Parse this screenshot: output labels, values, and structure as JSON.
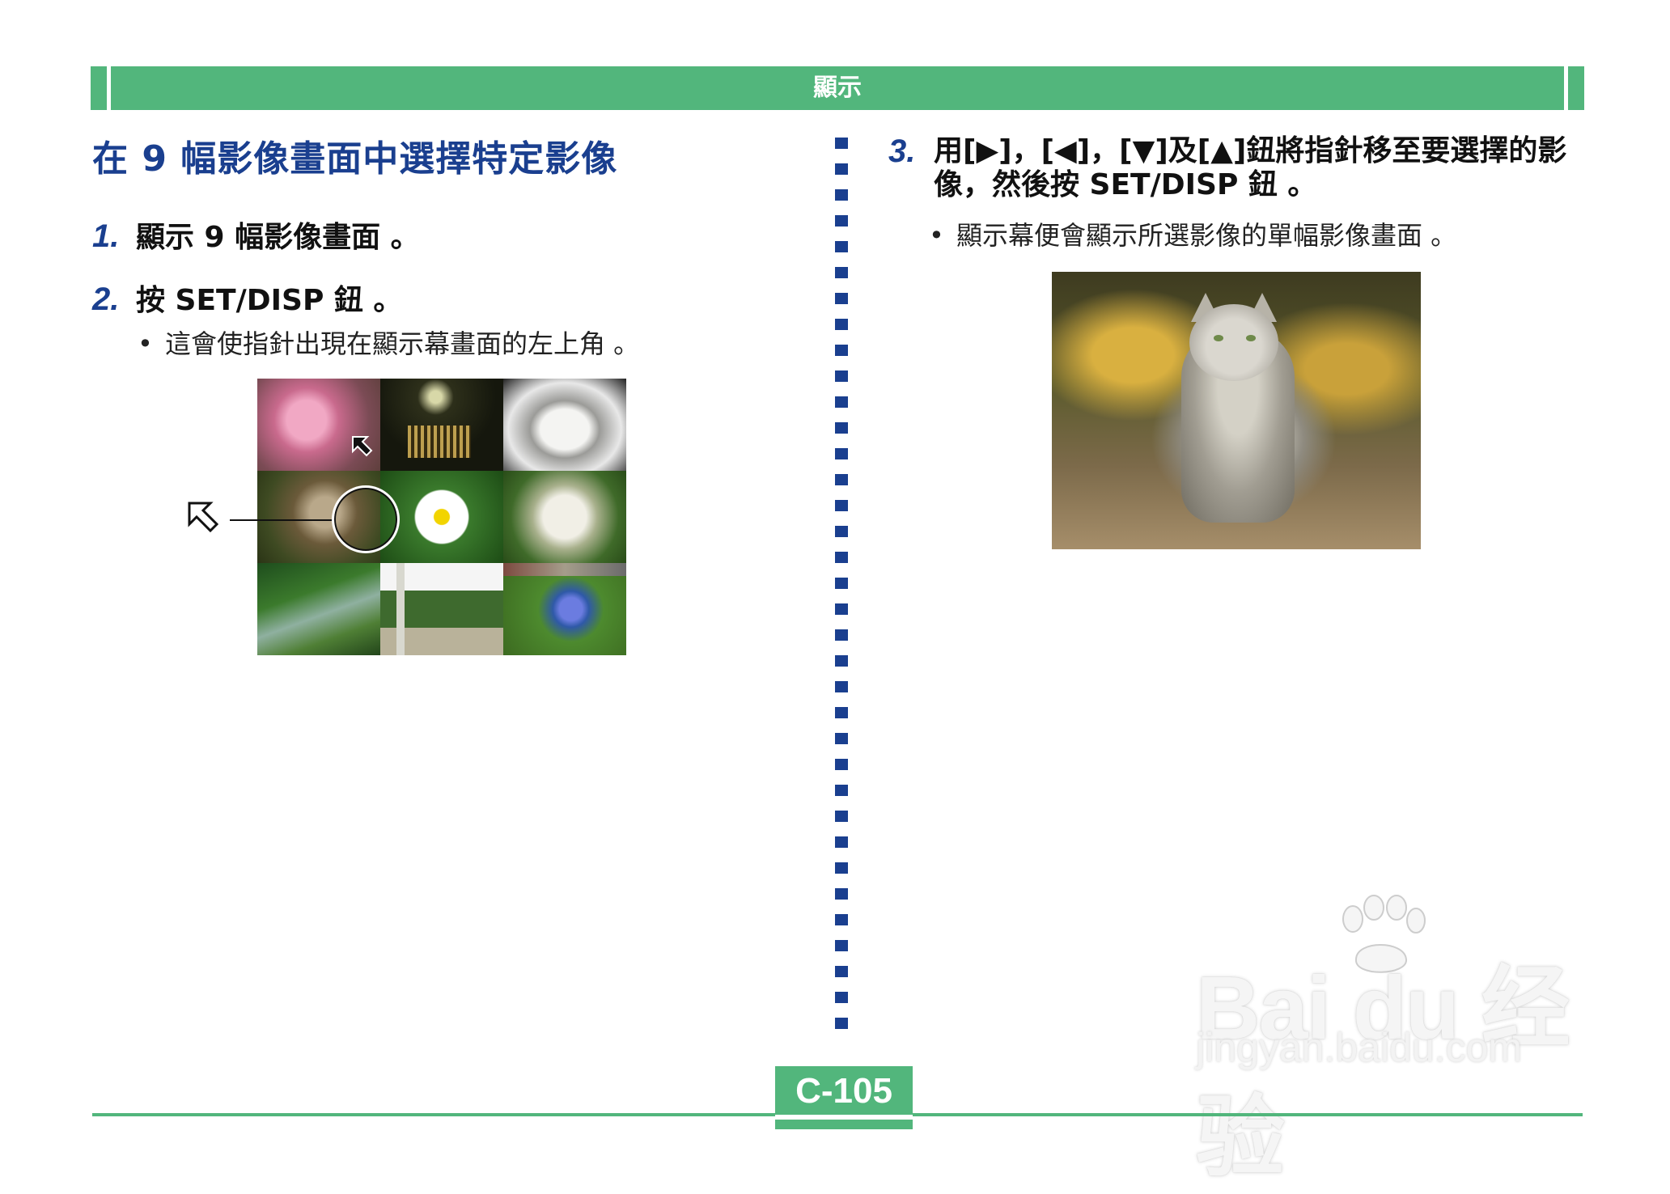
{
  "header": {
    "title": "顯示"
  },
  "left": {
    "section_title": "在 9 幅影像畫面中選擇特定影像",
    "step1": {
      "num": "1.",
      "text": "顯示 9 幅影像畫面 。"
    },
    "step2": {
      "num": "2.",
      "text": "按 SET/DISP 鈕 。"
    },
    "bullet2": {
      "dot": "•",
      "text": "這會使指針出現在顯示幕畫面的左上角 。"
    }
  },
  "right": {
    "step3": {
      "num": "3.",
      "text": "用[▶]，[◀]，[▼]及[▲]鈕將指針移至要選擇的影像，然後按 SET/DISP 鈕 。"
    },
    "bullet3": {
      "dot": "•",
      "text": "顯示幕便會顯示所選影像的單幅影像畫面 。"
    }
  },
  "watermark": {
    "brand": "Bai du 经验",
    "url": "jingyan.baidu.com"
  },
  "footer": {
    "page_number": "C-105"
  },
  "colors": {
    "green": "#52b67c",
    "blue": "#1a3f8f"
  },
  "icons": {
    "pointer": "pointer-arrow-icon",
    "paw": "paw-icon"
  }
}
